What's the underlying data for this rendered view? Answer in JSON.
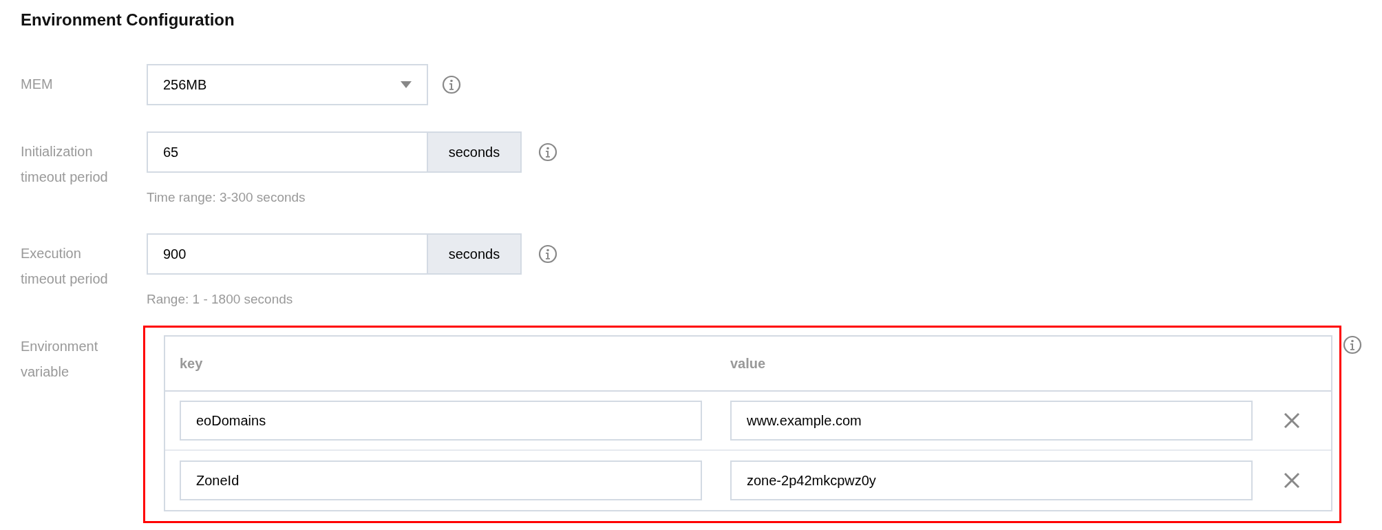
{
  "title": "Environment Configuration",
  "fields": [
    {
      "kind": "select",
      "label": "MEM",
      "value": "256MB"
    },
    {
      "kind": "input",
      "label": "Initialization timeout period",
      "value": "65",
      "addon": "seconds",
      "hint": "Time range: 3-300 seconds"
    },
    {
      "kind": "input",
      "label": "Execution timeout period",
      "value": "900",
      "addon": "seconds",
      "hint": "Range: 1 - 1800 seconds"
    }
  ],
  "env": {
    "label": "Environment variable",
    "highlighted": true,
    "columns": [
      "key",
      "value"
    ],
    "rows": [
      {
        "key": "eoDomains",
        "value": "www.example.com"
      },
      {
        "key": "ZoneId",
        "value": "zone-2p42mkcpwz0y"
      }
    ]
  }
}
